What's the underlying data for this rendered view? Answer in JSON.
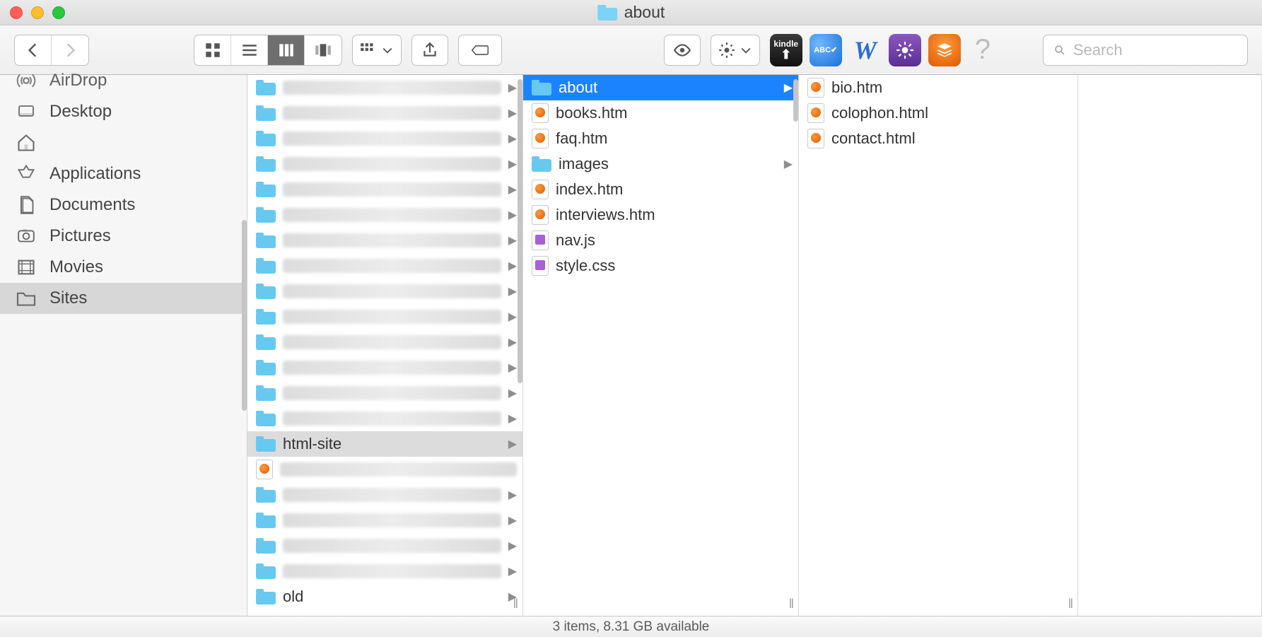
{
  "window": {
    "title": "about"
  },
  "toolbar": {
    "search_placeholder": "Search"
  },
  "sidebar": {
    "items": [
      {
        "label": "AirDrop"
      },
      {
        "label": "Desktop"
      },
      {
        "label": ""
      },
      {
        "label": "Applications"
      },
      {
        "label": "Documents"
      },
      {
        "label": "Pictures"
      },
      {
        "label": "Movies"
      },
      {
        "label": "Sites"
      }
    ],
    "selected_index": 7
  },
  "columns": {
    "col1": {
      "blurred_folder_rows_before": 14,
      "selected": {
        "label": "html-site",
        "type": "folder"
      },
      "after": [
        {
          "type": "file",
          "label": ""
        },
        {
          "type": "folder",
          "label": ""
        },
        {
          "type": "folder",
          "label": ""
        },
        {
          "type": "folder",
          "label": ""
        },
        {
          "type": "folder",
          "label": ""
        },
        {
          "type": "folder",
          "label": "old"
        }
      ]
    },
    "col2": {
      "items": [
        {
          "type": "folder",
          "label": "about",
          "selected": true,
          "has_children": true
        },
        {
          "type": "file",
          "label": "books.htm",
          "icon": "html"
        },
        {
          "type": "file",
          "label": "faq.htm",
          "icon": "html"
        },
        {
          "type": "folder",
          "label": "images",
          "has_children": true
        },
        {
          "type": "file",
          "label": "index.htm",
          "icon": "html"
        },
        {
          "type": "file",
          "label": "interviews.htm",
          "icon": "html"
        },
        {
          "type": "file",
          "label": "nav.js",
          "icon": "js"
        },
        {
          "type": "file",
          "label": "style.css",
          "icon": "css"
        }
      ]
    },
    "col3": {
      "items": [
        {
          "type": "file",
          "label": "bio.htm",
          "icon": "html"
        },
        {
          "type": "file",
          "label": "colophon.html",
          "icon": "html"
        },
        {
          "type": "file",
          "label": "contact.html",
          "icon": "html"
        }
      ]
    }
  },
  "status": {
    "text": "3 items, 8.31 GB available"
  }
}
